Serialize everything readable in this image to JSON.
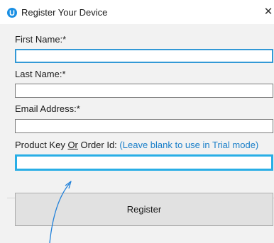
{
  "window": {
    "title": "Register Your Device",
    "icon": "app-logo-icon",
    "close_glyph": "✕"
  },
  "form": {
    "first_name": {
      "label": "First Name:*",
      "value": ""
    },
    "last_name": {
      "label": "Last Name:*",
      "value": ""
    },
    "email": {
      "label": "Email Address:*",
      "value": ""
    },
    "product_key": {
      "label_prefix": "Product Key ",
      "label_or": "Or",
      "label_suffix": " Order Id: ",
      "hint": "(Leave blank to use in Trial mode)",
      "value": ""
    },
    "register_label": "Register"
  },
  "colors": {
    "accent": "#29aee6",
    "hint_text": "#1a7fc9",
    "annotation_arrow": "#1e7fd9"
  }
}
